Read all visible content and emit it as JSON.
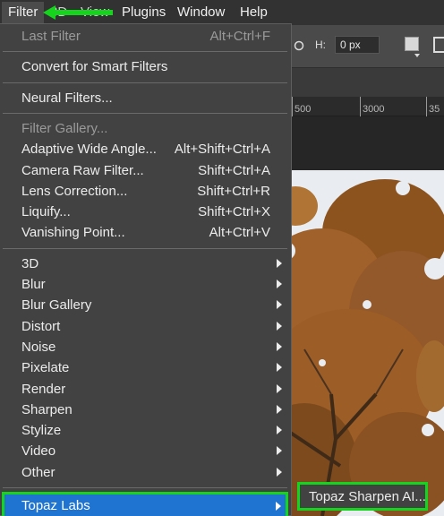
{
  "colors": {
    "menubar_bg": "#323232",
    "menu_bg": "#424242",
    "highlight_bg": "#1f73d1",
    "annotation_green": "#16d31e",
    "tree_foliage": "#a0612a",
    "sky": "#e9edf1"
  },
  "menubar": {
    "items": [
      {
        "label": "Filter",
        "active": true
      },
      {
        "label": "3D"
      },
      {
        "label": "View"
      },
      {
        "label": "Plugins"
      },
      {
        "label": "Window"
      },
      {
        "label": "Help"
      }
    ],
    "annotation": "green-arrow-icon"
  },
  "options_bar": {
    "height_label": "H:",
    "height_value": "0 px"
  },
  "ruler": {
    "ticks": [
      "500",
      "3000",
      "35"
    ]
  },
  "filter_menu": {
    "sections": [
      [
        {
          "label": "Last Filter",
          "shortcut": "Alt+Ctrl+F",
          "disabled": true
        }
      ],
      [
        {
          "label": "Convert for Smart Filters"
        }
      ],
      [
        {
          "label": "Neural Filters..."
        }
      ],
      [
        {
          "label": "Filter Gallery...",
          "disabled": true
        },
        {
          "label": "Adaptive Wide Angle...",
          "shortcut": "Alt+Shift+Ctrl+A"
        },
        {
          "label": "Camera Raw Filter...",
          "shortcut": "Shift+Ctrl+A"
        },
        {
          "label": "Lens Correction...",
          "shortcut": "Shift+Ctrl+R"
        },
        {
          "label": "Liquify...",
          "shortcut": "Shift+Ctrl+X"
        },
        {
          "label": "Vanishing Point...",
          "shortcut": "Alt+Ctrl+V"
        }
      ],
      [
        {
          "label": "3D",
          "submenu": true
        },
        {
          "label": "Blur",
          "submenu": true
        },
        {
          "label": "Blur Gallery",
          "submenu": true
        },
        {
          "label": "Distort",
          "submenu": true
        },
        {
          "label": "Noise",
          "submenu": true
        },
        {
          "label": "Pixelate",
          "submenu": true
        },
        {
          "label": "Render",
          "submenu": true
        },
        {
          "label": "Sharpen",
          "submenu": true
        },
        {
          "label": "Stylize",
          "submenu": true
        },
        {
          "label": "Video",
          "submenu": true
        },
        {
          "label": "Other",
          "submenu": true
        }
      ],
      [
        {
          "label": "Topaz Labs",
          "submenu": true,
          "highlighted": true
        }
      ]
    ]
  },
  "submenu": {
    "items": [
      {
        "label": "Topaz Sharpen AI..."
      }
    ]
  }
}
